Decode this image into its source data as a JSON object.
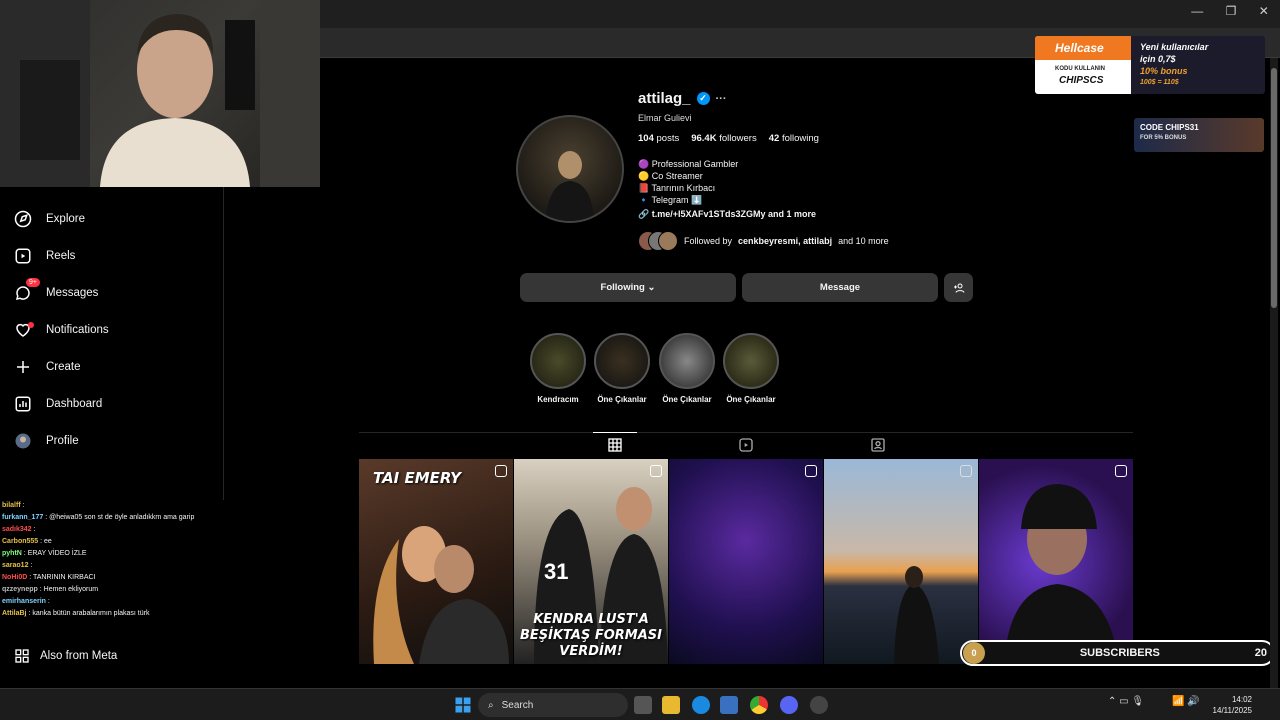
{
  "window": {
    "minimize": "—",
    "maximize": "❐",
    "close": "✕"
  },
  "sidebar": {
    "items": [
      {
        "label": "Explore",
        "icon": "compass-icon"
      },
      {
        "label": "Reels",
        "icon": "reels-icon"
      },
      {
        "label": "Messages",
        "icon": "messenger-icon",
        "badge": "9+"
      },
      {
        "label": "Notifications",
        "icon": "heart-icon"
      },
      {
        "label": "Create",
        "icon": "plus-icon"
      },
      {
        "label": "Dashboard",
        "icon": "dashboard-icon"
      },
      {
        "label": "Profile",
        "icon": "avatar-icon"
      }
    ],
    "also_meta": "Also from Meta"
  },
  "chat": [
    {
      "user": "bilalff",
      "text": "",
      "color": "#e5c04a"
    },
    {
      "user": "furkann_177",
      "text": "@heiwa05 son st de öyle anladıkkm ama garip",
      "color": "#7fd3ff"
    },
    {
      "user": "sadık342",
      "text": "",
      "color": "#ff4d4d"
    },
    {
      "user": "Carbon555",
      "text": "ee",
      "color": "#e5c04a"
    },
    {
      "user": "pyhtN",
      "text": "ERAY VİDEO İZLE",
      "color": "#7fff7f"
    },
    {
      "user": "sarao12",
      "text": "",
      "color": "#e5c04a"
    },
    {
      "user": "NoHi0D",
      "text": "TANRININ KIRBACI",
      "color": "#ff4d4d"
    },
    {
      "user": "qzzeynepp",
      "text": "Hemen ekliyorum",
      "color": "#bbbbbb"
    },
    {
      "user": "emirhanserin",
      "text": "",
      "color": "#7fd3ff"
    },
    {
      "user": "AttilaBj",
      "text": "kanka bütün arabalarımın plakası türk",
      "color": "#e5c04a"
    }
  ],
  "profile": {
    "username": "attilag_",
    "more": "···",
    "full_name": "Elmar Gulievi",
    "posts_count": "104",
    "posts_label": "posts",
    "followers_count": "96.4K",
    "followers_label": "followers",
    "following_count": "42",
    "following_label": "following",
    "bio": [
      "🟣 Professional Gambler",
      "🟡 Co Streamer",
      "📕 Tanrının Kırbacı",
      "🔹 Telegram ⬇️"
    ],
    "link": "t.me/+I5XAFv1STds3ZGMy and 1 more",
    "followed_by_prefix": "Followed by",
    "followed_by_names": "cenkbeyresmi, attilabj",
    "followed_by_suffix": "and 10 more"
  },
  "buttons": {
    "following": "Following",
    "message": "Message"
  },
  "highlights": [
    "Kendracım",
    "Öne Çıkanlar",
    "Öne Çıkanlar",
    "Öne Çıkanlar"
  ],
  "posts": [
    {
      "caption_top": "TAI EMERY",
      "caption_bottom": ""
    },
    {
      "caption_top": "",
      "caption_bottom": "KENDRA LUST'A BEŞİKTAŞ FORMASI VERDİM!"
    },
    {
      "caption_top": "",
      "caption_bottom": ""
    },
    {
      "caption_top": "",
      "caption_bottom": ""
    },
    {
      "caption_top": "",
      "caption_bottom": ""
    }
  ],
  "ads": {
    "hellcase_brand": "Hellcase",
    "hellcase_code_label": "KODU KULLANIN",
    "hellcase_code": "CHIPSCS",
    "hellcase_line1": "Yeni kullanıcılar",
    "hellcase_line2": "için 0,7$",
    "hellcase_line3": "10% bonus",
    "hellcase_line4": "100$ = 110$",
    "code_title": "CODE CHIPS31",
    "code_sub": "FOR 5% BONUS"
  },
  "subscribers": {
    "left_count": "0",
    "label": "SUBSCRIBERS",
    "right_count": "20"
  },
  "taskbar": {
    "search": "Search",
    "time": "14:02",
    "date": "14/11/2025"
  }
}
